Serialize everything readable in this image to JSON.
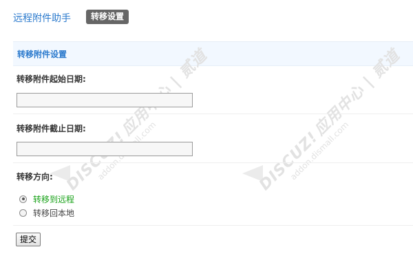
{
  "header": {
    "app_title": "远程附件助手",
    "active_tab": "转移设置"
  },
  "section": {
    "title": "转移附件设置"
  },
  "form": {
    "start_date": {
      "label": "转移附件起始日期:",
      "value": ""
    },
    "end_date": {
      "label": "转移附件截止日期:",
      "value": ""
    },
    "direction": {
      "label": "转移方向:",
      "options": [
        {
          "label": "转移到远程",
          "checked": true
        },
        {
          "label": "转移回本地",
          "checked": false
        }
      ]
    },
    "submit_label": "提交"
  },
  "watermark": {
    "brand": "DISCUZ!",
    "tagline": "应用中心 | 贰道",
    "domain": "addon.dismall.com"
  },
  "colors": {
    "link_blue": "#2b7acd",
    "selected_green": "#16a116",
    "header_bg": "#f2f8ff",
    "tab_badge_bg": "#666666"
  }
}
